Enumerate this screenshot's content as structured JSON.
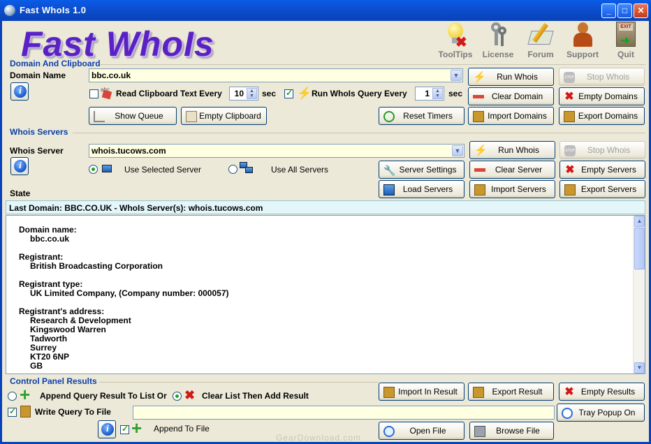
{
  "window": {
    "title": "Fast WhoIs 1.0",
    "min": "_",
    "max": "□",
    "close": "✕"
  },
  "logo": "Fast WhoIs",
  "toolbar": [
    {
      "label": "ToolTips",
      "icon": "bulb-icon"
    },
    {
      "label": "License",
      "icon": "keys-icon"
    },
    {
      "label": "Forum",
      "icon": "pencil-icon"
    },
    {
      "label": "Support",
      "icon": "support-person-icon"
    },
    {
      "label": "Quit",
      "icon": "exit-icon"
    }
  ],
  "domain": {
    "group_title": "Domain And Clipboard",
    "name_label": "Domain Name",
    "value": "bbc.co.uk",
    "read_clipboard_label": "Read Clipboard Text Every",
    "read_clipboard_value": "10",
    "read_clipboard_unit": "sec",
    "run_query_label": "Run WhoIs Query Every",
    "run_query_value": "1",
    "run_query_unit": "sec",
    "show_queue": "Show Queue",
    "empty_clipboard": "Empty Clipboard",
    "reset_timers": "Reset Timers",
    "run_whois": "Run Whois",
    "stop_whois": "Stop Whois",
    "clear_domain": "Clear Domain",
    "empty_domains": "Empty Domains",
    "import_domains": "Import Domains",
    "export_domains": "Export Domains"
  },
  "servers": {
    "group_title": "Whois Servers",
    "server_label": "Whois Server",
    "value": "whois.tucows.com",
    "use_selected": "Use Selected Server",
    "use_all": "Use All Servers",
    "server_settings": "Server Settings",
    "load_servers": "Load Servers",
    "run_whois": "Run Whois",
    "stop_whois": "Stop Whois",
    "clear_server": "Clear Server",
    "empty_servers": "Empty Servers",
    "import_servers": "Import Servers",
    "export_servers": "Export Servers"
  },
  "state": {
    "label": "State",
    "text": "Last Domain: BBC.CO.UK  -  WhoIs Server(s): whois.tucows.com"
  },
  "result": [
    {
      "heading": "Domain name:",
      "lines": [
        "bbc.co.uk"
      ]
    },
    {
      "heading": "Registrant:",
      "lines": [
        "British Broadcasting Corporation"
      ]
    },
    {
      "heading": "Registrant type:",
      "lines": [
        "UK Limited Company, (Company number: 000057)"
      ]
    },
    {
      "heading": "Registrant's address:",
      "lines": [
        "Research & Development",
        "Kingswood Warren",
        "Tadworth",
        "Surrey",
        "KT20 6NP",
        "GB"
      ]
    }
  ],
  "control": {
    "group_title": "Control Panel Results",
    "append_label": "Append Query Result To List Or",
    "clear_label": "Clear List Then Add Result",
    "write_label": "Write Query To File",
    "append_file_label": "Append To File",
    "import_result": "Import In Result",
    "export_result": "Export Result",
    "empty_results": "Empty Results",
    "tray_popup": "Tray Popup On",
    "open_file": "Open File",
    "browse_file": "Browse File"
  },
  "watermark": "GearDownload.com"
}
